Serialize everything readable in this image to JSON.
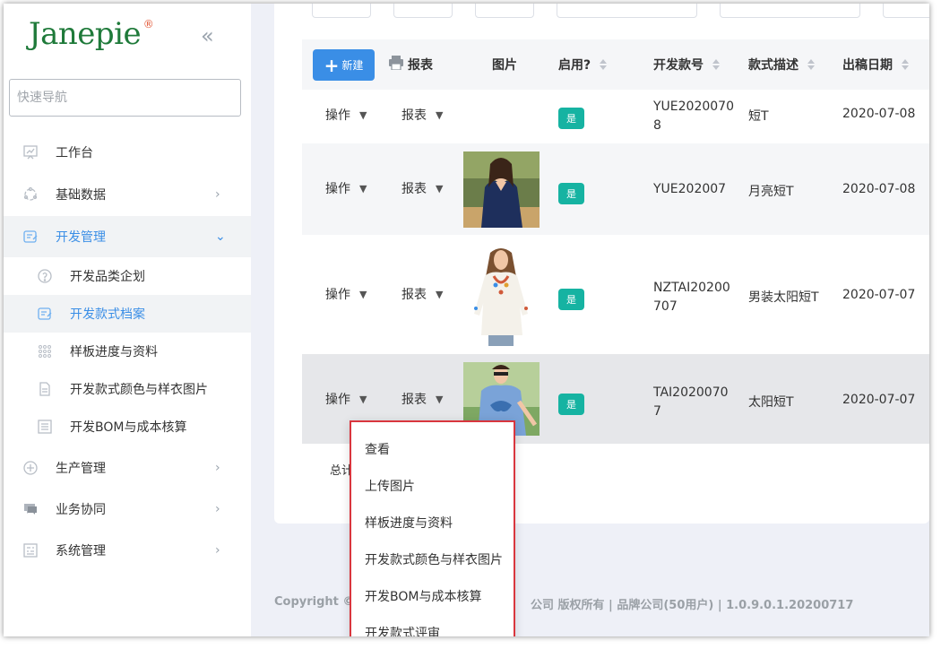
{
  "brand": {
    "logo_text": "Janepie",
    "reg_mark": "®"
  },
  "sidebar": {
    "collapse_icon": "«",
    "quicknav_placeholder": "快速导航",
    "items": [
      {
        "label": "工作台",
        "icon": "dashboard-icon"
      },
      {
        "label": "基础数据",
        "icon": "data-icon"
      },
      {
        "label": "开发管理",
        "icon": "dev-icon"
      },
      {
        "label": "生产管理",
        "icon": "production-icon"
      },
      {
        "label": "业务协同",
        "icon": "chat-icon"
      },
      {
        "label": "系统管理",
        "icon": "settings-icon"
      }
    ],
    "sub_items": [
      {
        "label": "开发品类企划",
        "icon": "question-icon"
      },
      {
        "label": "开发款式档案",
        "icon": "archive-icon"
      },
      {
        "label": "样板进度与资料",
        "icon": "grid-icon"
      },
      {
        "label": "开发款式颜色与样衣图片",
        "icon": "document-icon"
      },
      {
        "label": "开发BOM与成本核算",
        "icon": "list-icon"
      }
    ]
  },
  "table": {
    "new_button": "新建",
    "headers": {
      "report": "报表",
      "image": "图片",
      "enabled": "启用?",
      "dev_code": "开发款号",
      "style_desc": "款式描述",
      "release_date": "出稿日期"
    },
    "row_action_label": "操作",
    "row_report_label": "报表",
    "rows": [
      {
        "enabled": "是",
        "code": "YUE20200708",
        "desc": "短T",
        "date": "2020-07-08"
      },
      {
        "enabled": "是",
        "code": "YUE202007",
        "desc": "月亮短T",
        "date": "2020-07-08"
      },
      {
        "enabled": "是",
        "code": "NZTAI20200707",
        "desc": "男装太阳短T",
        "date": "2020-07-07"
      },
      {
        "enabled": "是",
        "code": "TAI20200707",
        "desc": "太阳短T",
        "date": "2020-07-07"
      }
    ],
    "total_label": "总计:"
  },
  "dropdown": {
    "items": [
      "查看",
      "上传图片",
      "样板进度与资料",
      "开发款式颜色与样衣图片",
      "开发BOM与成本核算",
      "开发款式评审"
    ]
  },
  "footer": {
    "left": "Copyright ©",
    "right": "公司 版权所有 | 品牌公司(50用户) | 1.0.9.0.1.20200717"
  },
  "colors": {
    "accent": "#3a8ee6",
    "badge": "#16b3a2",
    "highlight_border": "#d9363e",
    "brand_green": "#1f7a3a"
  }
}
